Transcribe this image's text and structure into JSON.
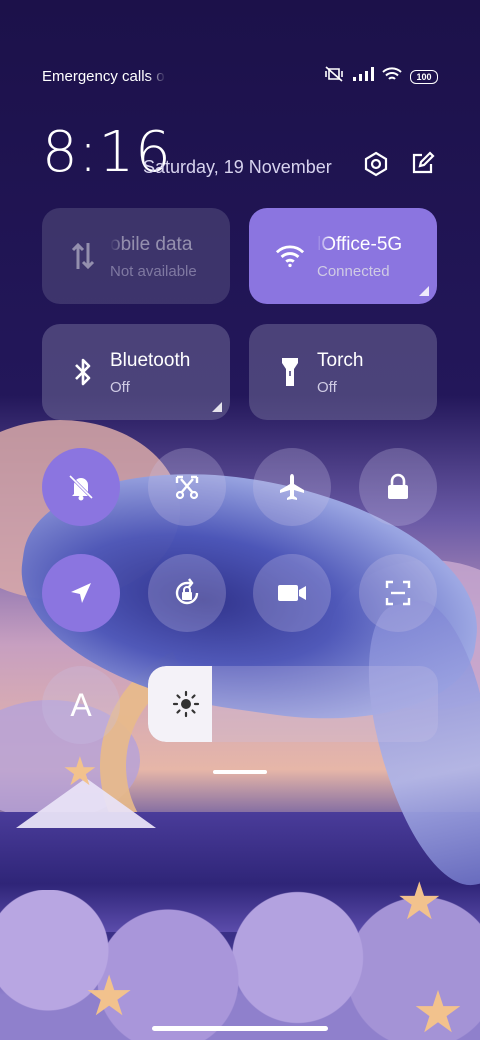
{
  "status_bar": {
    "carrier": "Emergency calls o",
    "battery": "100",
    "icons": [
      "mute-vibrate-icon",
      "signal-icon",
      "wifi-icon",
      "battery-icon"
    ]
  },
  "header": {
    "time": "8:16",
    "date": "Saturday, 19 November",
    "settings_icon": "settings-hex-icon",
    "edit_icon": "edit-icon"
  },
  "tiles": {
    "mobile_data": {
      "title": "obile data",
      "subtitle": "Not available",
      "icon": "mobile-data-arrows-icon",
      "state": "disabled"
    },
    "wifi": {
      "title": "lOffice-5G",
      "subtitle": "Connected",
      "icon": "wifi-icon",
      "state": "on"
    },
    "bluetooth": {
      "title": "Bluetooth",
      "subtitle": "Off",
      "icon": "bluetooth-icon",
      "state": "off"
    },
    "torch": {
      "title": "Torch",
      "subtitle": "Off",
      "icon": "torch-icon",
      "state": "off"
    }
  },
  "toggles": [
    {
      "name": "silent",
      "icon": "bell-off-icon",
      "on": true
    },
    {
      "name": "screenshot",
      "icon": "scissors-icon",
      "on": false
    },
    {
      "name": "airplane",
      "icon": "airplane-icon",
      "on": false
    },
    {
      "name": "lock",
      "icon": "lock-icon",
      "on": false
    },
    {
      "name": "location",
      "icon": "location-arrow-icon",
      "on": true
    },
    {
      "name": "auto-rotate-lock",
      "icon": "rotate-lock-icon",
      "on": false
    },
    {
      "name": "screen-record",
      "icon": "video-camera-icon",
      "on": false
    },
    {
      "name": "scanner",
      "icon": "scan-icon",
      "on": false
    }
  ],
  "font_toggle": {
    "label": "A"
  },
  "brightness": {
    "level": 0.22,
    "icon": "sun-icon"
  },
  "colors": {
    "accent": "#8b75e0",
    "tile": "#6e6896",
    "background": "#1f1450"
  }
}
